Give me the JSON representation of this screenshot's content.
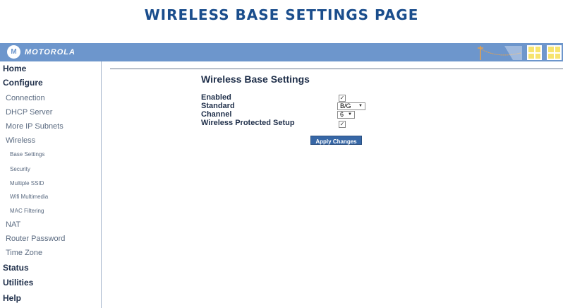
{
  "page_heading": "WIRELESS BASE SETTINGS PAGE",
  "brand": {
    "logo_text": "MOTOROLA",
    "logo_mark": "M",
    "color": "#6d96cc"
  },
  "sidebar": {
    "home": "Home",
    "configure": "Configure",
    "connection": "Connection",
    "dhcp_server": "DHCP Server",
    "more_ip_subnets": "More IP Subnets",
    "wireless": "Wireless",
    "base_settings": "Base Settings",
    "security": "Security",
    "multiple_ssid": "Multiple SSID",
    "wifi_multimedia": "Wifi Multimedia",
    "mac_filtering": "MAC Filtering",
    "nat": "NAT",
    "router_password": "Router Password",
    "time_zone": "Time Zone",
    "status": "Status",
    "utilities": "Utilities",
    "help": "Help"
  },
  "form": {
    "title": "Wireless Base Settings",
    "enabled_label": "Enabled",
    "enabled_checked": true,
    "standard_label": "Standard",
    "standard_value": "B/G",
    "channel_label": "Channel",
    "channel_value": "6",
    "wps_label": "Wireless Protected Setup",
    "wps_checked": true,
    "apply_button": "Apply Changes"
  },
  "icons": {
    "enabled_check": "check-icon",
    "wps_check": "check-icon",
    "dropdown": "caret-down-icon"
  },
  "colors": {
    "heading": "#1a4d8c",
    "topbar": "#6d96cc",
    "button": "#3767a6",
    "window": "#f7e46e"
  }
}
